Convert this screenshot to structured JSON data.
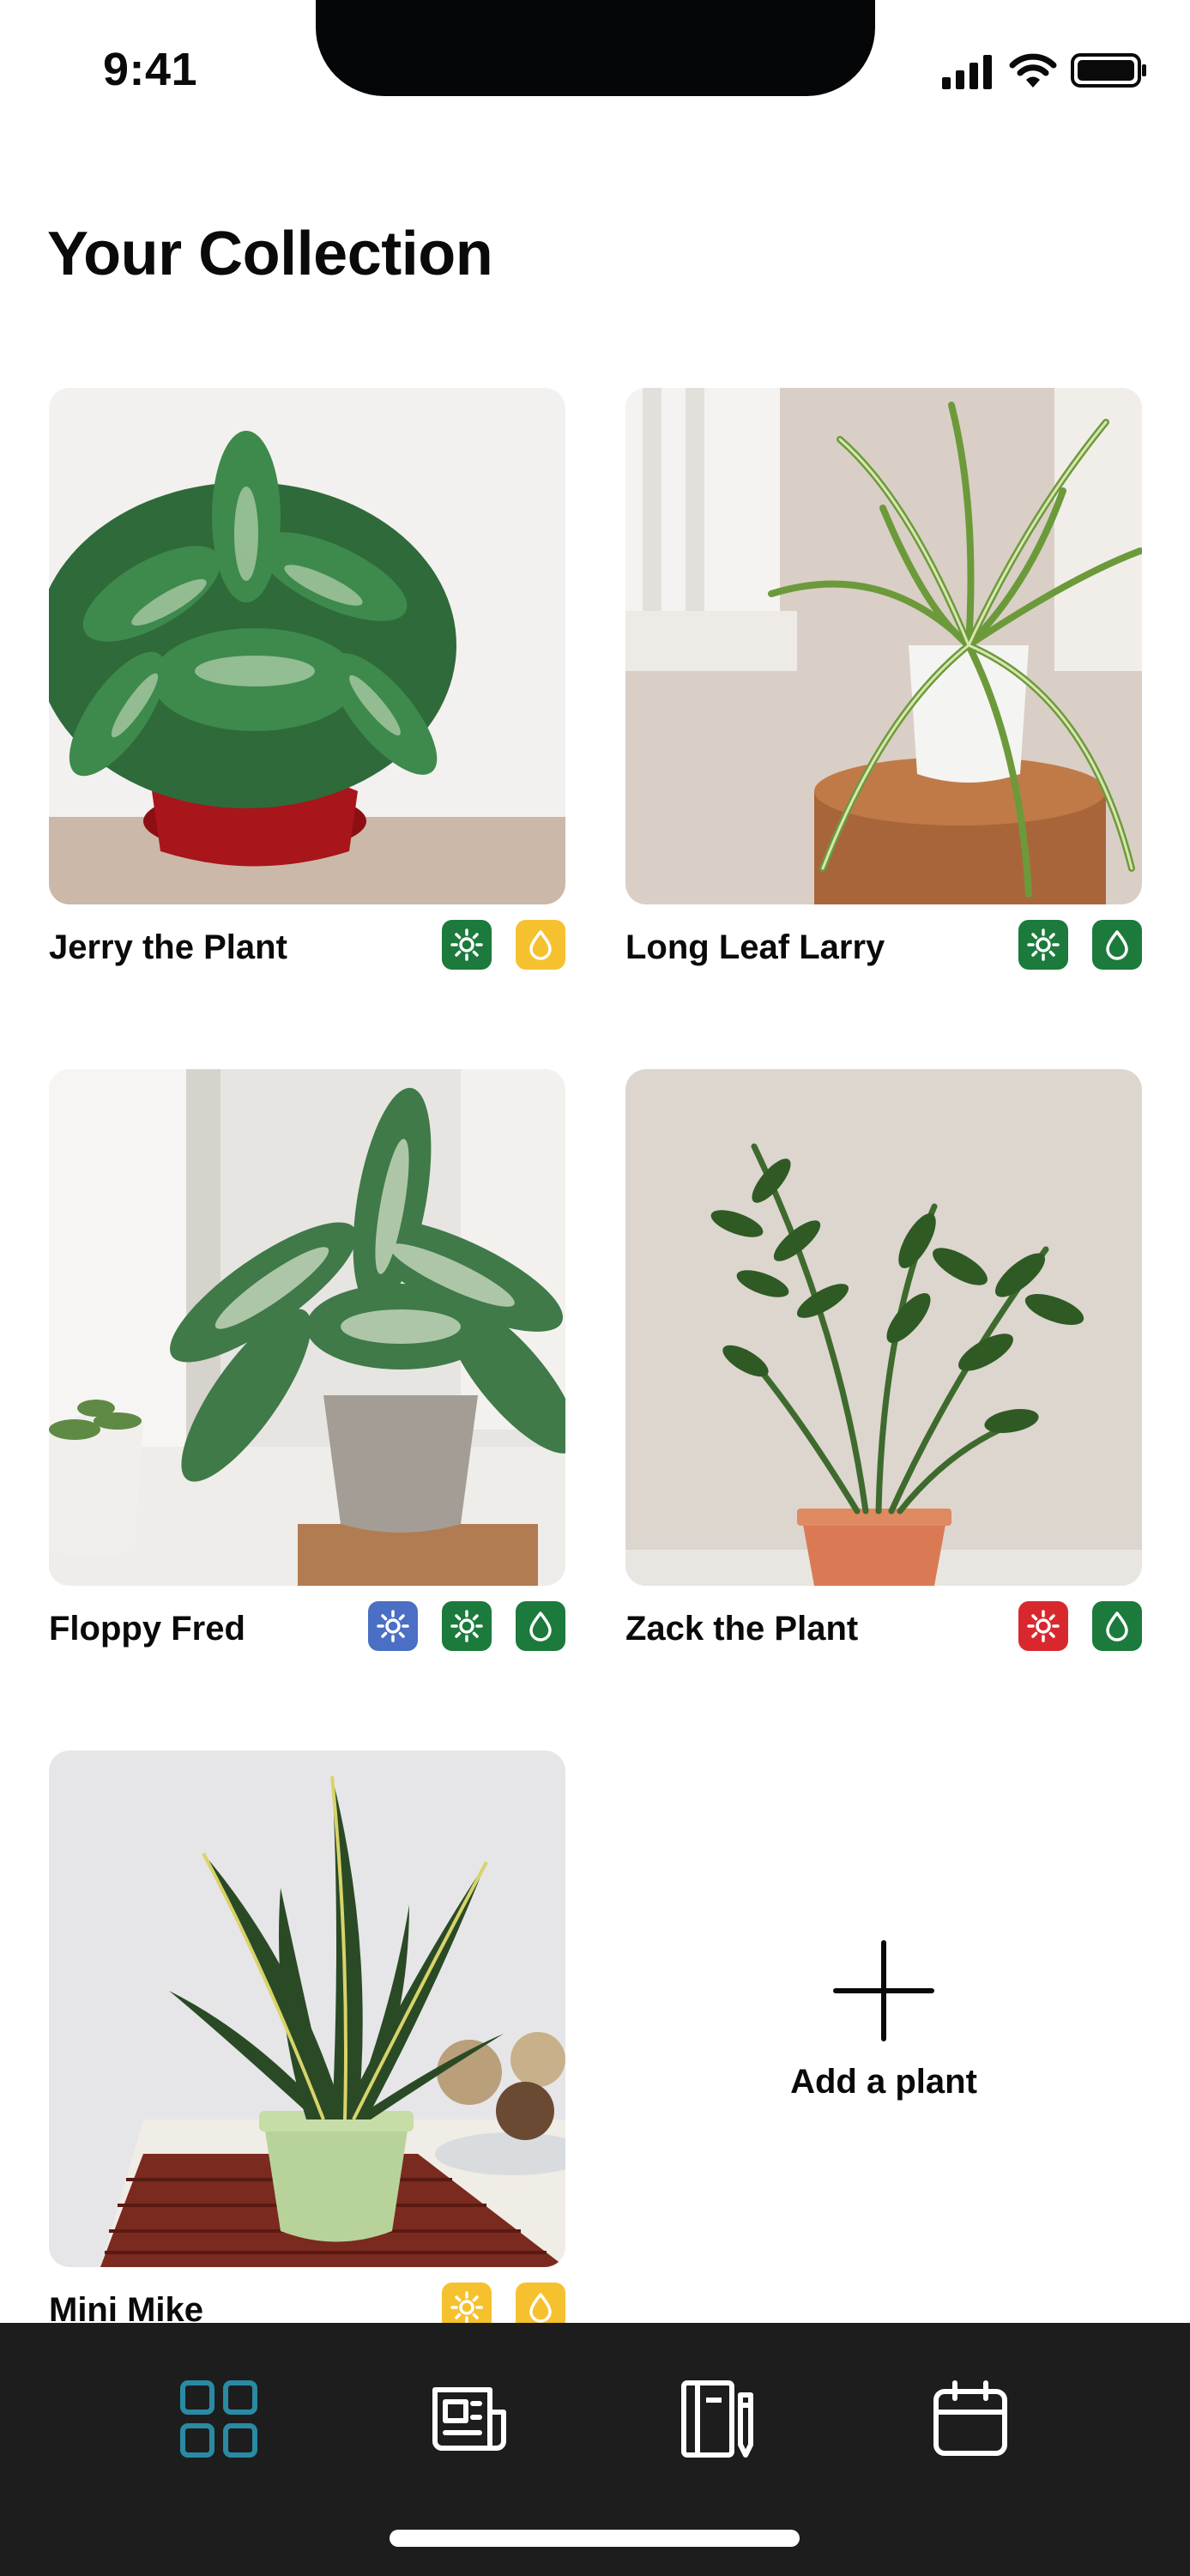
{
  "status_bar": {
    "time": "9:41"
  },
  "title": "Your Collection",
  "colors": {
    "green": "#1b7a3c",
    "yellow": "#f5c12e",
    "blue": "#4a6fc4",
    "red": "#d8282e",
    "accent_teal": "#2a8aa3",
    "tab_bar": "#1d1d1d"
  },
  "plants": [
    {
      "name": "Jerry the Plant",
      "badges": [
        "sun-green",
        "water-yellow"
      ]
    },
    {
      "name": "Long Leaf Larry",
      "badges": [
        "sun-green",
        "water-green"
      ]
    },
    {
      "name": "Floppy Fred",
      "badges": [
        "sun-blue",
        "sun-green",
        "water-green"
      ]
    },
    {
      "name": "Zack the Plant",
      "badges": [
        "sun-red",
        "water-green"
      ]
    },
    {
      "name": "Mini Mike",
      "badges": [
        "sun-yellow",
        "water-yellow"
      ]
    }
  ],
  "add_plant": {
    "label": "Add a plant",
    "icon": "plus-icon"
  },
  "tabs": [
    {
      "name": "collection",
      "icon": "grid-icon",
      "active": true
    },
    {
      "name": "news",
      "icon": "newspaper-icon",
      "active": false
    },
    {
      "name": "journal",
      "icon": "notebook-pen-icon",
      "active": false
    },
    {
      "name": "calendar",
      "icon": "calendar-icon",
      "active": false
    }
  ]
}
